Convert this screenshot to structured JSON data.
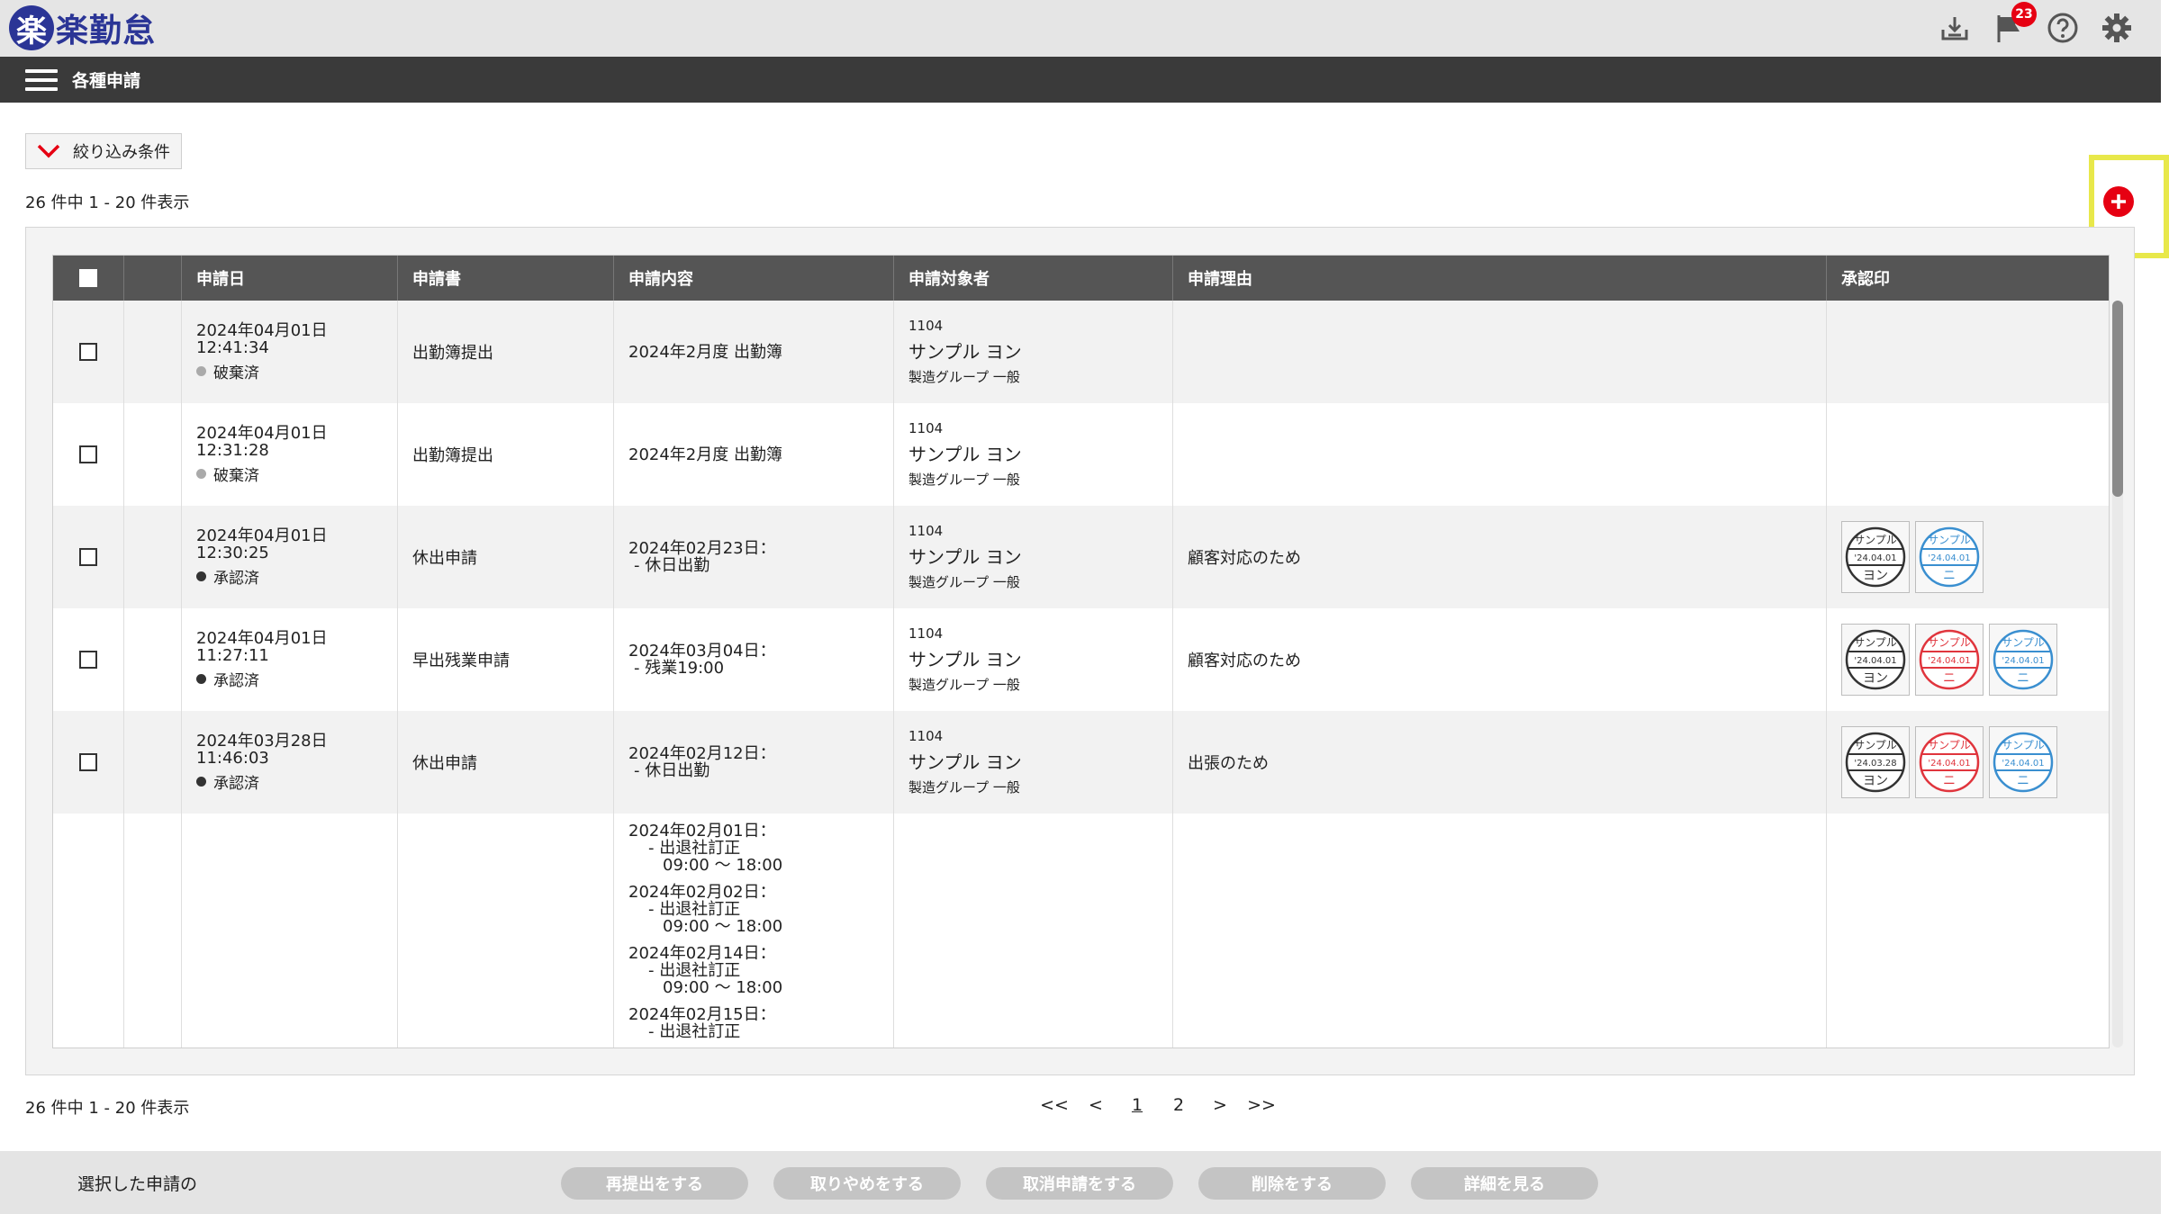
{
  "app": {
    "logo_mark": "楽",
    "logo_text": "楽勤怠",
    "notification_count": "23",
    "icons": [
      "download-tray-icon",
      "flag-icon",
      "help-icon",
      "gear-icon"
    ]
  },
  "nav": {
    "title": "各種申請"
  },
  "filter": {
    "label": "絞り込み条件"
  },
  "count_text": "26 件中 1 - 20 件表示",
  "table": {
    "headers": [
      "申請日",
      "申請書",
      "申請内容",
      "申請対象者",
      "申請理由",
      "承認印"
    ],
    "rows": [
      {
        "date": "2024年04月01日",
        "time": "12:41:34",
        "status": "破棄済",
        "status_color": "#aaaaaa",
        "form": "出勤簿提出",
        "content": [
          "2024年2月度 出勤簿"
        ],
        "emp_id": "1104",
        "emp_name": "サンプル ヨン",
        "emp_group": "製造グループ 一般",
        "reason": "",
        "stamps": []
      },
      {
        "date": "2024年04月01日",
        "time": "12:31:28",
        "status": "破棄済",
        "status_color": "#aaaaaa",
        "form": "出勤簿提出",
        "content": [
          "2024年2月度 出勤簿"
        ],
        "emp_id": "1104",
        "emp_name": "サンプル ヨン",
        "emp_group": "製造グループ 一般",
        "reason": "",
        "stamps": []
      },
      {
        "date": "2024年04月01日",
        "time": "12:30:25",
        "status": "承認済",
        "status_color": "#333333",
        "form": "休出申請",
        "content": [
          "2024年02月23日：",
          "- 休日出勤"
        ],
        "emp_id": "1104",
        "emp_name": "サンプル ヨン",
        "emp_group": "製造グループ 一般",
        "reason": "顧客対応のため",
        "stamps": [
          {
            "top": "サンプル",
            "date": "'24.04.01",
            "bottom": "ヨン",
            "color": "#333333"
          },
          {
            "top": "サンプル",
            "date": "'24.04.01",
            "bottom": "ニ",
            "color": "#3a8fd0"
          }
        ]
      },
      {
        "date": "2024年04月01日",
        "time": "11:27:11",
        "status": "承認済",
        "status_color": "#333333",
        "form": "早出残業申請",
        "content": [
          "2024年03月04日：",
          "- 残業19:00"
        ],
        "emp_id": "1104",
        "emp_name": "サンプル ヨン",
        "emp_group": "製造グループ 一般",
        "reason": "顧客対応のため",
        "stamps": [
          {
            "top": "サンプル",
            "date": "'24.04.01",
            "bottom": "ヨン",
            "color": "#333333"
          },
          {
            "top": "サンプル",
            "date": "'24.04.01",
            "bottom": "ニ",
            "color": "#e0353d"
          },
          {
            "top": "サンプル",
            "date": "'24.04.01",
            "bottom": "ニ",
            "color": "#3a8fd0"
          }
        ]
      },
      {
        "date": "2024年03月28日",
        "time": "11:46:03",
        "status": "承認済",
        "status_color": "#333333",
        "form": "休出申請",
        "content": [
          "2024年02月12日：",
          "- 休日出勤"
        ],
        "emp_id": "1104",
        "emp_name": "サンプル ヨン",
        "emp_group": "製造グループ 一般",
        "reason": "出張のため",
        "stamps": [
          {
            "top": "サンプル",
            "date": "'24.03.28",
            "bottom": "ヨン",
            "color": "#333333"
          },
          {
            "top": "サンプル",
            "date": "'24.04.01",
            "bottom": "ニ",
            "color": "#e0353d"
          },
          {
            "top": "サンプル",
            "date": "'24.04.01",
            "bottom": "ニ",
            "color": "#3a8fd0"
          }
        ]
      }
    ],
    "partial_row_content": [
      "2024年02月01日：",
      "- 出退社訂正",
      "09:00 ～ 18:00",
      "2024年02月02日：",
      "- 出退社訂正",
      "09:00 ～ 18:00",
      "2024年02月14日：",
      "- 出退社訂正",
      "09:00 ～ 18:00",
      "2024年02月15日：",
      "- 出退社訂正"
    ]
  },
  "pagination": [
    "<<",
    "<",
    "1",
    "2",
    ">",
    ">>"
  ],
  "bottom": {
    "label": "選択した申請の",
    "buttons": [
      "再提出をする",
      "取りやめをする",
      "取消申請をする",
      "削除をする",
      "詳細を見る"
    ]
  }
}
